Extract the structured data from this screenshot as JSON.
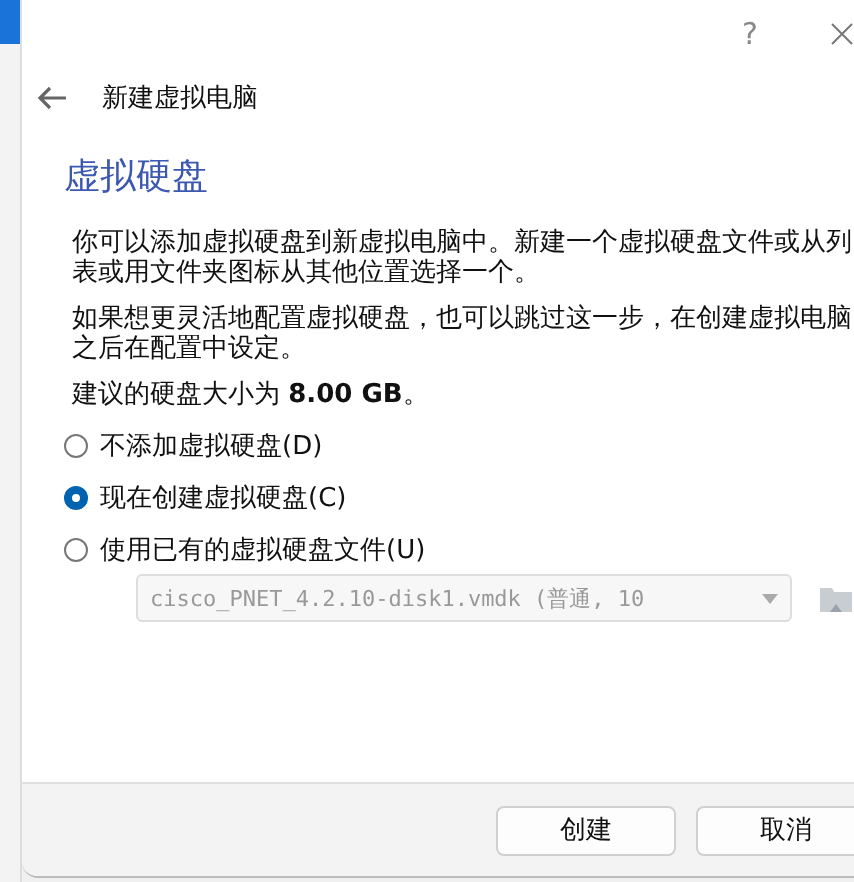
{
  "window": {
    "help": "?"
  },
  "header": {
    "title": "新建虚拟电脑"
  },
  "page": {
    "heading": "虚拟硬盘",
    "paragraphs": [
      "你可以添加虚拟硬盘到新虚拟电脑中。新建一个虚拟硬盘文件或从列表或用文件夹图标从其他位置选择一个。",
      "如果想更灵活地配置虚拟硬盘，也可以跳过这一步，在创建虚拟电脑之后在配置中设定。",
      "建议的硬盘大小为 **8.00 GB**。"
    ],
    "options": [
      {
        "label": "不添加虚拟硬盘(D)",
        "selected": false
      },
      {
        "label": "现在创建虚拟硬盘(C)",
        "selected": true
      },
      {
        "label": "使用已有的虚拟硬盘文件(U)",
        "selected": false
      }
    ],
    "file_combo": {
      "value": "cisco_PNET_4.2.10-disk1.vmdk (普通, 10",
      "disabled": true
    }
  },
  "buttons": [
    "创建",
    "取消"
  ]
}
